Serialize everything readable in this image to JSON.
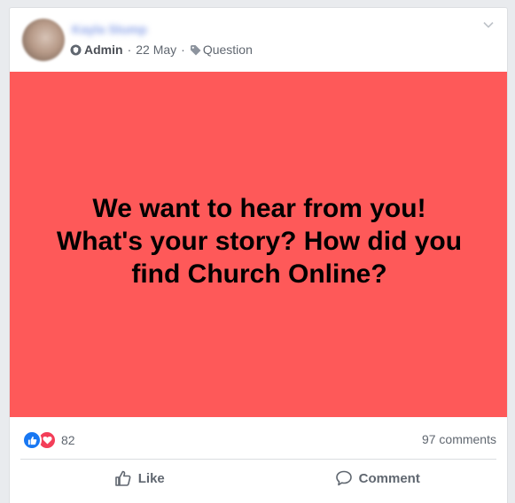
{
  "post": {
    "author_name": "Kayla Stump",
    "role": "Admin",
    "date": "22 May",
    "separator": "·",
    "tag": "Question",
    "text": "We want to hear from you! What's your story? How did you find Church Online?",
    "background_color": "#fe5959"
  },
  "engagement": {
    "reaction_count": "82",
    "comments": "97 comments",
    "reaction_icons": [
      "like-icon",
      "love-icon"
    ]
  },
  "actions": {
    "like_label": "Like",
    "comment_label": "Comment"
  },
  "icons": {
    "role": "admin-shield-icon",
    "tag": "tag-icon",
    "menu": "chevron-down-icon"
  }
}
